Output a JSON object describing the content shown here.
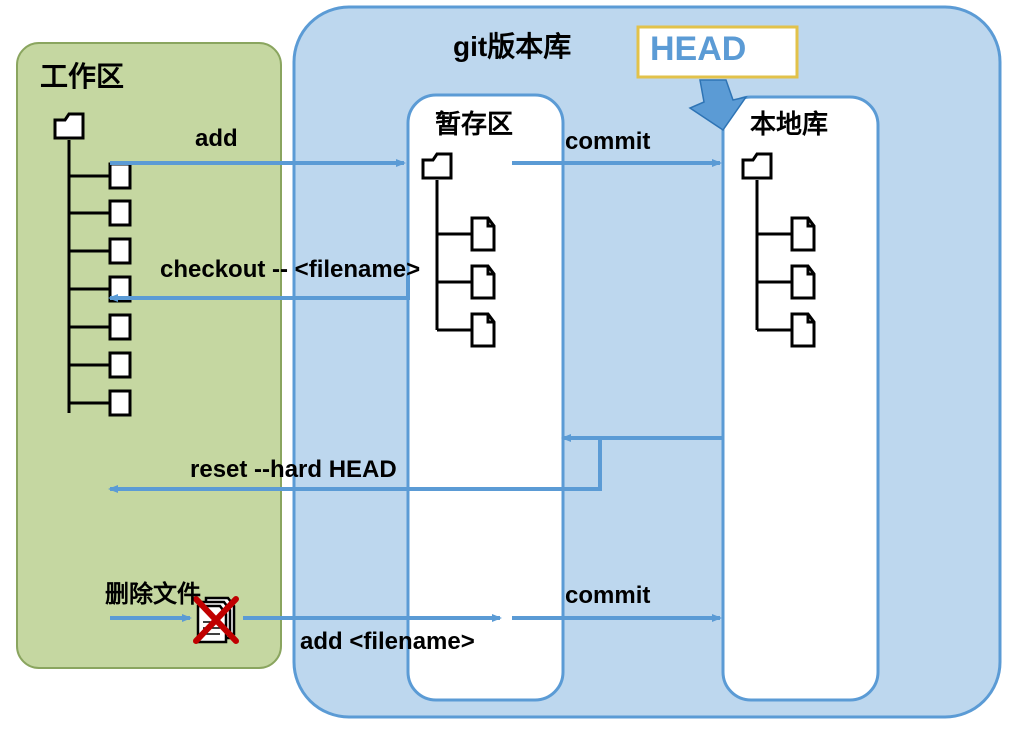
{
  "working_area": {
    "label": "工作区"
  },
  "repo": {
    "label": "git版本库",
    "head_label": "HEAD",
    "stage_label": "暂存区",
    "local_label": "本地库"
  },
  "arrows": {
    "add": "add",
    "commit_top": "commit",
    "checkout": "checkout -- <filename>",
    "reset": "reset --hard HEAD",
    "delete_label": "删除文件",
    "add_filename": "add  <filename>",
    "commit_bottom": "commit"
  },
  "colors": {
    "green_fill": "#c5d7a1",
    "green_stroke": "#8aa55f",
    "blue_fill": "#bdd7ee",
    "blue_stroke": "#5b9bd5",
    "arrow": "#5b9bd5",
    "head_stroke": "#e2c24a",
    "head_text": "#5b9bd5",
    "red": "#c00000"
  }
}
